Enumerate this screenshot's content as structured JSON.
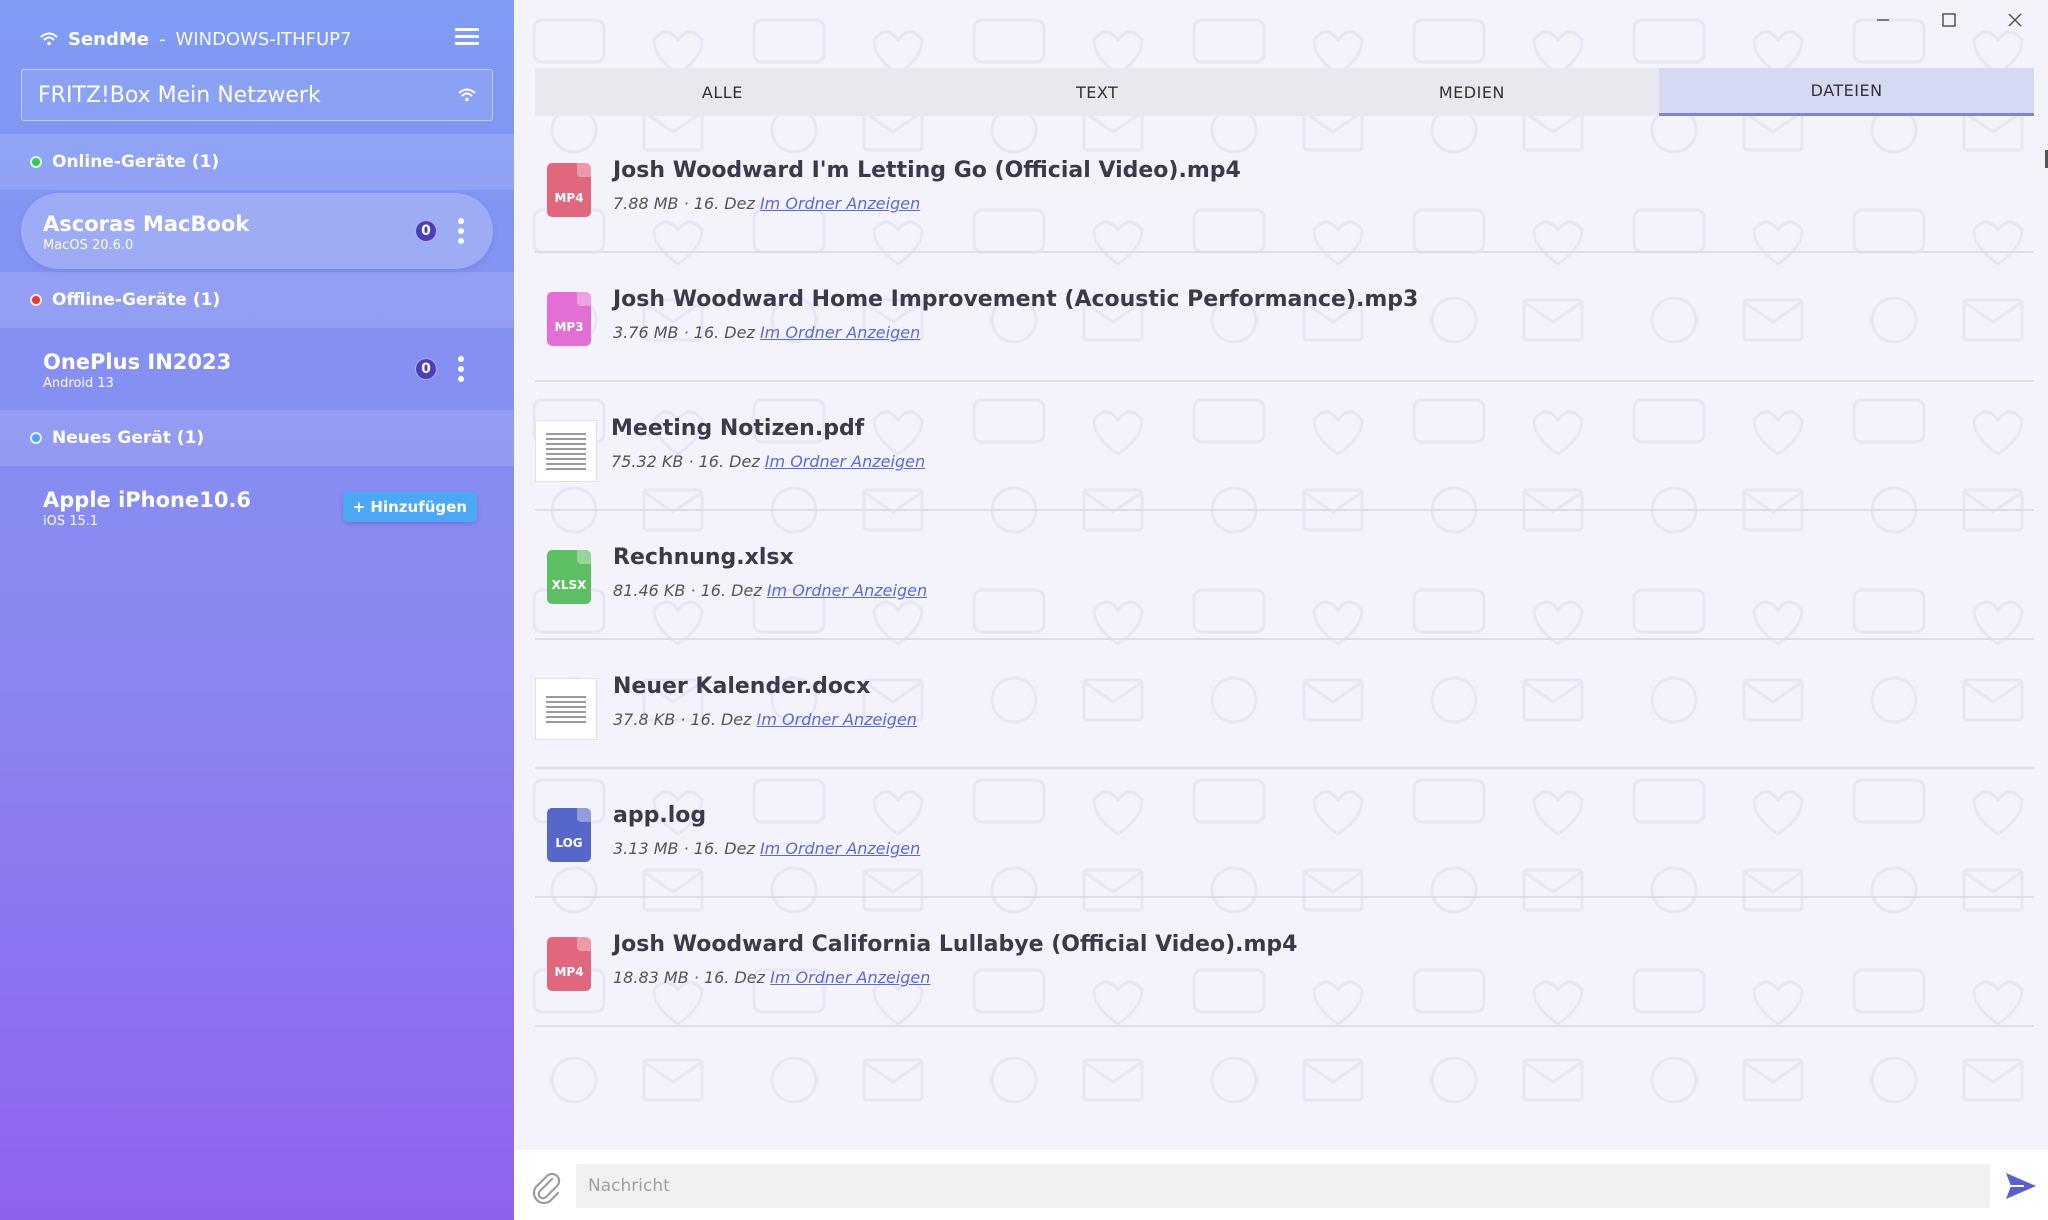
{
  "app": {
    "name": "SendMe",
    "separator": "-",
    "host": "WINDOWS-ITHFUP7"
  },
  "network": {
    "name": "FRITZ!Box Mein Netzwerk"
  },
  "sections": {
    "online": {
      "label": "Online-Geräte (1)",
      "color": "#34c759"
    },
    "offline": {
      "label": "Offline-Geräte (1)",
      "color": "#e53935"
    },
    "new": {
      "label": "Neues Gerät (1)",
      "color": "#4fa3ff"
    }
  },
  "devices": {
    "online": [
      {
        "name": "Ascoras MacBook",
        "os": "MacOS 20.6.0",
        "badge": "0"
      }
    ],
    "offline": [
      {
        "name": "OnePlus IN2023",
        "os": "Android 13",
        "badge": "0"
      }
    ],
    "new": [
      {
        "name": "Apple iPhone10.6",
        "os": "iOS 15.1",
        "add_label": "+ Hinzufügen"
      }
    ]
  },
  "tabs": [
    {
      "label": "ALLE"
    },
    {
      "label": "TEXT"
    },
    {
      "label": "MEDIEN"
    },
    {
      "label": "DATEIEN",
      "active": true
    }
  ],
  "files": [
    {
      "name": "Josh Woodward I'm Letting Go (Official Video).mp4",
      "size": "7.88 MB",
      "date": "16. Dez",
      "link": "Im Ordner Anzeigen",
      "icon": "MP4",
      "icon_color": "#e1677f"
    },
    {
      "name": "Josh Woodward Home Improvement (Acoustic Performance).mp3",
      "size": "3.76 MB",
      "date": "16. Dez",
      "link": "Im Ordner Anzeigen",
      "icon": "MP3",
      "icon_color": "#e36fd4"
    },
    {
      "name": "Meeting Notizen.pdf",
      "size": "75.32 KB",
      "date": "16. Dez",
      "link": "Im Ordner Anzeigen",
      "icon": "pdf-thumbnail"
    },
    {
      "name": "Rechnung.xlsx",
      "size": "81.46 KB",
      "date": "16. Dez",
      "link": "Im Ordner Anzeigen",
      "icon": "XLSX",
      "icon_color": "#5cbf63"
    },
    {
      "name": "Neuer Kalender.docx",
      "size": "37.8 KB",
      "date": "16. Dez",
      "link": "Im Ordner Anzeigen",
      "icon": "docx-thumbnail"
    },
    {
      "name": "app.log",
      "size": "3.13 MB",
      "date": "16. Dez",
      "link": "Im Ordner Anzeigen",
      "icon": "LOG",
      "icon_color": "#5568c9"
    },
    {
      "name": "Josh Woodward California Lullabye (Official Video).mp4",
      "size": "18.83 MB",
      "date": "16. Dez",
      "link": "Im Ordner Anzeigen",
      "icon": "MP4",
      "icon_color": "#e1677f"
    }
  ],
  "message": {
    "placeholder": "Nachricht"
  },
  "colors": {
    "accent": "#7e84db",
    "send": "#5a5fcf",
    "link": "#5a6bd6"
  }
}
